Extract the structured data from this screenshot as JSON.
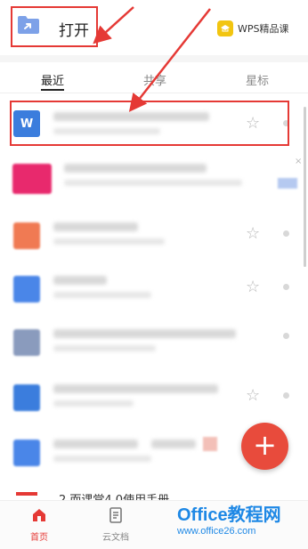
{
  "header": {
    "open_label": "打开",
    "course_label": "WPS精品课"
  },
  "tabs": [
    {
      "label": "最近",
      "active": true
    },
    {
      "label": "共享",
      "active": false
    },
    {
      "label": "星标",
      "active": false
    }
  ],
  "rows": [
    {
      "icon_color": "#3b7ddd",
      "icon_letter": "W",
      "starred": false,
      "highlighted": true
    },
    {
      "icon_color": "#e8296d",
      "starred": false
    },
    {
      "icon_color": "#f07a53",
      "starred": false
    },
    {
      "icon_color": "#4a86e8",
      "starred": false
    },
    {
      "icon_color": "#8a9bbd",
      "starred": false
    },
    {
      "icon_color": "#3b7ddd",
      "starred": false
    },
    {
      "icon_color": "#4a86e8",
      "starred": false
    }
  ],
  "peek_row_title": "2.而课堂4.0使用手册",
  "fab": {
    "label": "+"
  },
  "bottom_nav": [
    {
      "label": "首页",
      "active": true
    },
    {
      "label": "云文档",
      "active": false
    },
    {
      "label": "",
      "active": false
    },
    {
      "label": "",
      "active": false
    }
  ],
  "watermark": {
    "title": "Office教程网",
    "url": "www.office26.com"
  },
  "colors": {
    "accent_red": "#e53935",
    "fab_red": "#e84b3c",
    "watermark_blue": "#1e88e5"
  }
}
